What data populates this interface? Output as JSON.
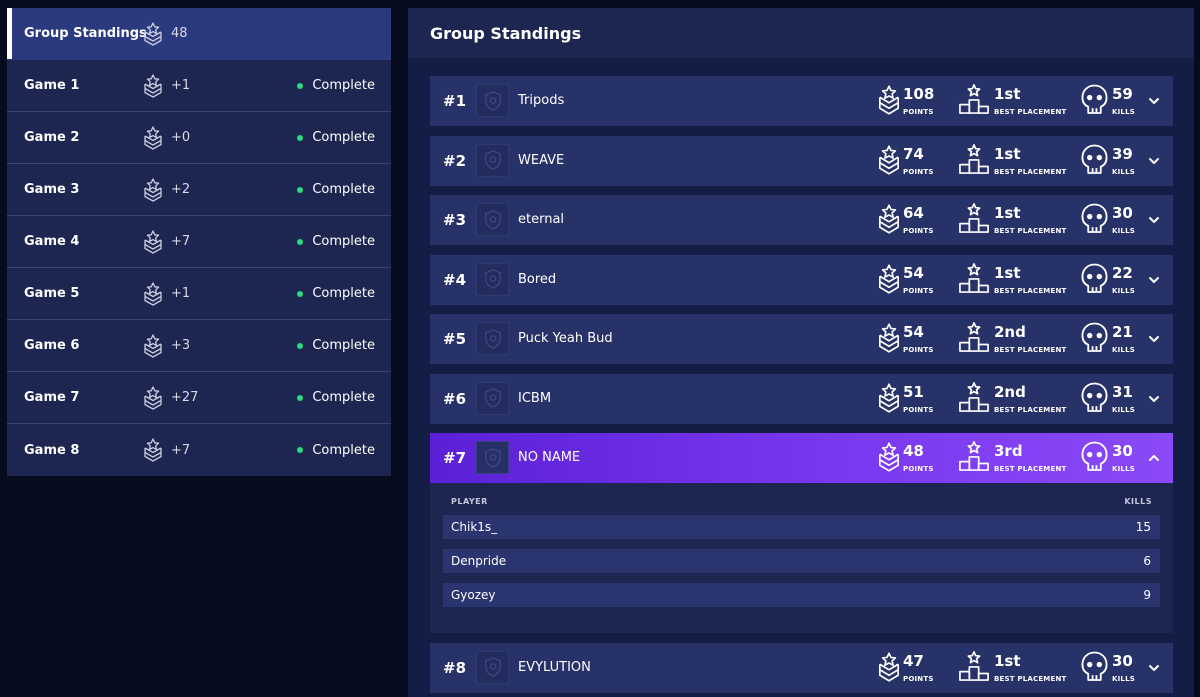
{
  "sidebar": {
    "items": [
      {
        "label": "Group Standings",
        "points": "48",
        "status": ""
      },
      {
        "label": "Game 1",
        "points": "+1",
        "status": "Complete"
      },
      {
        "label": "Game 2",
        "points": "+0",
        "status": "Complete"
      },
      {
        "label": "Game 3",
        "points": "+2",
        "status": "Complete"
      },
      {
        "label": "Game 4",
        "points": "+7",
        "status": "Complete"
      },
      {
        "label": "Game 5",
        "points": "+1",
        "status": "Complete"
      },
      {
        "label": "Game 6",
        "points": "+3",
        "status": "Complete"
      },
      {
        "label": "Game 7",
        "points": "+27",
        "status": "Complete"
      },
      {
        "label": "Game 8",
        "points": "+7",
        "status": "Complete"
      }
    ]
  },
  "main": {
    "title": "Group Standings",
    "stat_labels": {
      "points": "POINTS",
      "best_placement": "BEST PLACEMENT",
      "kills": "KILLS"
    },
    "teams": [
      {
        "rank": "#1",
        "name": "Tripods",
        "points": "108",
        "best": "1st",
        "kills": "59"
      },
      {
        "rank": "#2",
        "name": "WEAVE",
        "points": "74",
        "best": "1st",
        "kills": "39"
      },
      {
        "rank": "#3",
        "name": "eternal",
        "points": "64",
        "best": "1st",
        "kills": "30"
      },
      {
        "rank": "#4",
        "name": "Bored",
        "points": "54",
        "best": "1st",
        "kills": "22"
      },
      {
        "rank": "#5",
        "name": "Puck Yeah Bud",
        "points": "54",
        "best": "2nd",
        "kills": "21"
      },
      {
        "rank": "#6",
        "name": "ICBM",
        "points": "51",
        "best": "2nd",
        "kills": "31"
      },
      {
        "rank": "#7",
        "name": "NO NAME",
        "points": "48",
        "best": "3rd",
        "kills": "30"
      },
      {
        "rank": "#8",
        "name": "EVYLUTION",
        "points": "47",
        "best": "1st",
        "kills": "30"
      }
    ],
    "expanded": {
      "player_header": "PLAYER",
      "kills_header": "KILLS",
      "players": [
        {
          "name": "Chik1s_",
          "kills": "15"
        },
        {
          "name": "Denpride",
          "kills": "6"
        },
        {
          "name": "Gyozey",
          "kills": "9"
        }
      ]
    }
  },
  "colors": {
    "background": "#060c1e",
    "panel": "#1c2650",
    "row": "#273268",
    "active_sidebar": "#2b3a7e",
    "expanded_row": "#7a38ef",
    "status_dot": "#2ed87c"
  },
  "icons": {
    "points": "chevron-rank-star-icon",
    "best_placement": "podium-star-icon",
    "kills": "skull-icon",
    "team_logo": "shield-icon",
    "expand": "chevron-down-icon",
    "collapse": "chevron-up-icon"
  }
}
